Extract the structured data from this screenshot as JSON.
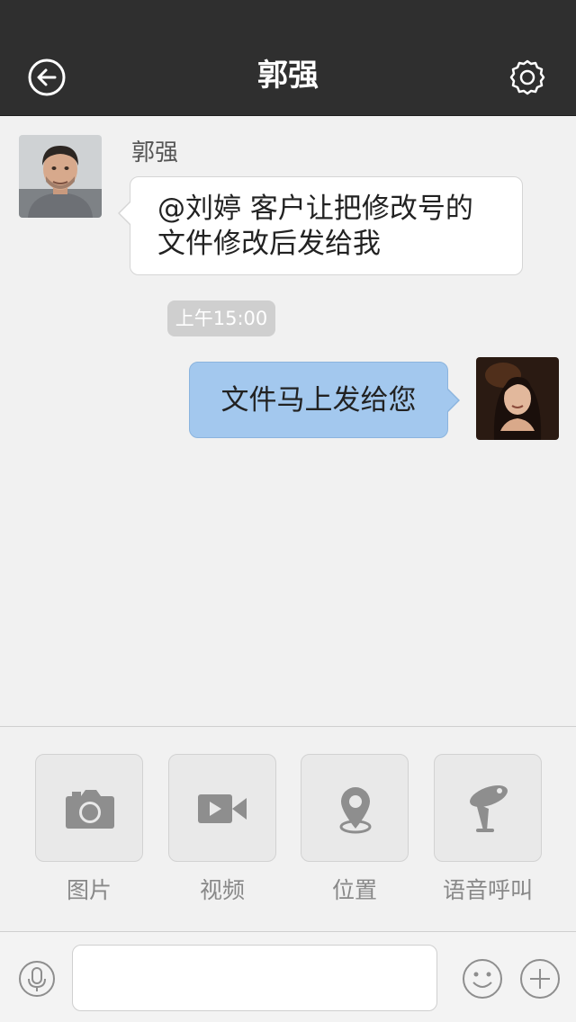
{
  "header": {
    "title": "郭强"
  },
  "messages": {
    "incoming": {
      "sender": "郭强",
      "line1": "@刘婷 客户让把修改号的",
      "line2": "文件修改后发给我"
    },
    "time": "上午15:00",
    "outgoing": {
      "text": "文件马上发给您"
    }
  },
  "actions": [
    {
      "label": "图片",
      "icon": "camera-icon"
    },
    {
      "label": "视频",
      "icon": "video-icon"
    },
    {
      "label": "位置",
      "icon": "location-icon"
    },
    {
      "label": "语音呼叫",
      "icon": "voice-call-icon"
    }
  ],
  "input": {
    "placeholder": ""
  },
  "colors": {
    "nav_bg": "#2f2f2f",
    "page_bg": "#f1f1f1",
    "outgoing_bubble": "#a3c8ee",
    "incoming_bubble": "#ffffff",
    "icon_gray": "#8e8e8e"
  }
}
